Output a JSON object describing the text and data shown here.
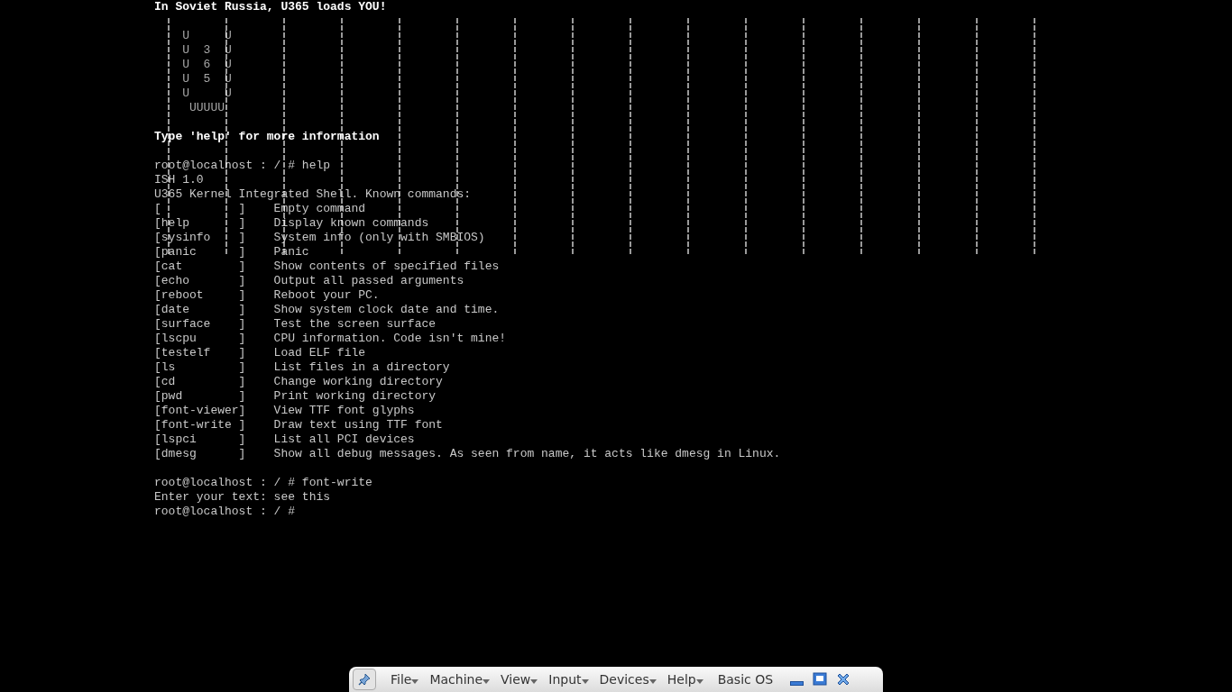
{
  "console": {
    "lines": [
      {
        "kind": "heading",
        "text": "In Soviet Russia, U365 loads YOU!"
      },
      {
        "kind": "blank"
      },
      {
        "kind": "logo",
        "text": "    U     U"
      },
      {
        "kind": "logo",
        "text": "    U  3  U"
      },
      {
        "kind": "logo",
        "text": "    U  6  U"
      },
      {
        "kind": "logo",
        "text": "    U  5  U"
      },
      {
        "kind": "logo",
        "text": "    U     U"
      },
      {
        "kind": "logo",
        "text": "     UUUUU"
      },
      {
        "kind": "blank"
      },
      {
        "kind": "heading",
        "text": "Type 'help' for more information"
      },
      {
        "kind": "blank"
      },
      {
        "kind": "output",
        "text": "root@localhost : / # help"
      },
      {
        "kind": "output",
        "text": "ISH 1.0"
      },
      {
        "kind": "output",
        "text": "U365 Kernel Integrated Shell. Known commands:"
      },
      {
        "kind": "output",
        "text": "[           ]    Empty command"
      },
      {
        "kind": "output",
        "text": "[help       ]    Display known commands"
      },
      {
        "kind": "output",
        "text": "[sysinfo    ]    System info (only with SMBIOS)"
      },
      {
        "kind": "output",
        "text": "[panic      ]    Panic"
      },
      {
        "kind": "output",
        "text": "[cat        ]    Show contents of specified files"
      },
      {
        "kind": "output",
        "text": "[echo       ]    Output all passed arguments"
      },
      {
        "kind": "output",
        "text": "[reboot     ]    Reboot your PC."
      },
      {
        "kind": "output",
        "text": "[date       ]    Show system clock date and time."
      },
      {
        "kind": "output",
        "text": "[surface    ]    Test the screen surface"
      },
      {
        "kind": "output",
        "text": "[lscpu      ]    CPU information. Code isn't mine!"
      },
      {
        "kind": "output",
        "text": "[testelf    ]    Load ELF file"
      },
      {
        "kind": "output",
        "text": "[ls         ]    List files in a directory"
      },
      {
        "kind": "output",
        "text": "[cd         ]    Change working directory"
      },
      {
        "kind": "output",
        "text": "[pwd        ]    Print working directory"
      },
      {
        "kind": "output",
        "text": "[font-viewer]    View TTF font glyphs"
      },
      {
        "kind": "output",
        "text": "[font-write ]    Draw text using TTF font"
      },
      {
        "kind": "output",
        "text": "[lspci      ]    List all PCI devices"
      },
      {
        "kind": "output",
        "text": "[dmesg      ]    Show all debug messages. As seen from name, it acts like dmesg in Linux."
      },
      {
        "kind": "blank"
      },
      {
        "kind": "output",
        "text": "root@localhost : / # font-write"
      },
      {
        "kind": "output",
        "text": "Enter your text: see this"
      },
      {
        "kind": "output",
        "text": "root@localhost : / #"
      }
    ]
  },
  "toolbar": {
    "pinned": true,
    "menus": [
      {
        "label": "File"
      },
      {
        "label": "Machine"
      },
      {
        "label": "View"
      },
      {
        "label": "Input"
      },
      {
        "label": "Devices"
      },
      {
        "label": "Help"
      }
    ],
    "title": "Basic OS"
  }
}
